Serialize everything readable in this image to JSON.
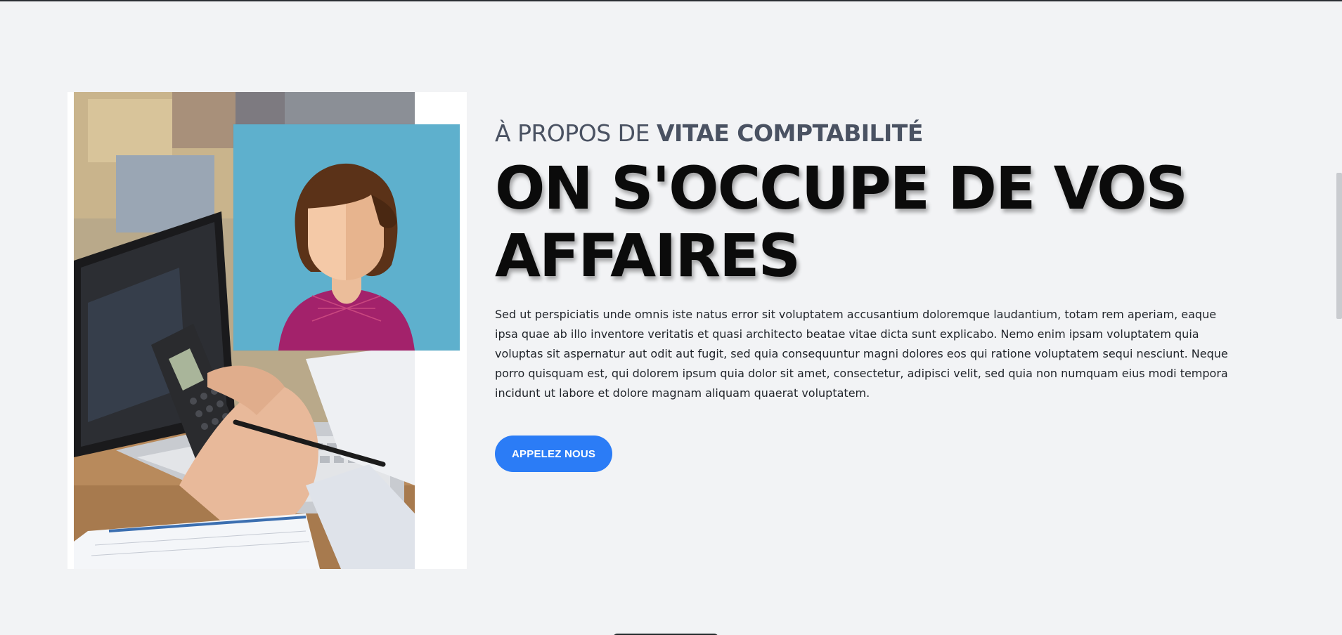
{
  "about": {
    "kicker_prefix": "À PROPOS DE",
    "kicker_brand": "VITAE COMPTABILITÉ",
    "headline": "ON S'OCCUPE DE VOS AFFAIRES",
    "paragraph": "Sed ut perspiciatis unde omnis iste natus error sit voluptatem accusantium doloremque laudantium, totam rem aperiam, eaque ipsa quae ab illo inventore veritatis et quasi architecto beatae vitae dicta sunt explicabo. Nemo enim ipsam voluptatem quia voluptas sit aspernatur aut odit aut fugit, sed quia consequuntur magni dolores eos qui ratione voluptatem sequi nesciunt. Neque porro quisquam est, qui dolorem ipsum quia dolor sit amet, consectetur, adipisci velit, sed quia non numquam eius modi tempora incidunt ut labore et dolore magnam aliquam quaerat voluptatem.",
    "cta_label": "APPELEZ NOUS"
  },
  "images": {
    "photo_icon": "accountant-calculator-laptop-photo",
    "avatar_icon": "woman-avatar-icon"
  },
  "colors": {
    "background": "#f2f3f5",
    "accent": "#2b7cf6",
    "kicker": "#4a5262",
    "headline": "#0b0b0b",
    "avatar_bg": "#5eb0cd"
  }
}
